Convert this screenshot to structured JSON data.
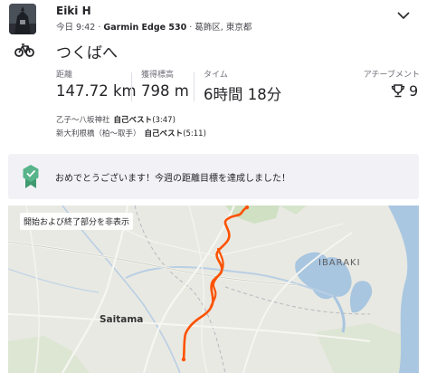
{
  "header": {
    "athlete_name": "Eiki H",
    "timestamp": "今日 9:42",
    "device": "Garmin Edge 530",
    "location": "葛飾区, 東京都",
    "separator": " · ",
    "avatar_icon": "profile-photo",
    "menu_icon": "chevron-down-icon"
  },
  "activity": {
    "sport_icon": "bicycle-icon",
    "title": "つくばへ"
  },
  "stats": {
    "distance_label": "距離",
    "distance_value": "147.72 km",
    "elevation_label": "獲得標高",
    "elevation_value": "798 m",
    "time_label": "タイム",
    "time_value": "6時間 18分",
    "achievements_label": "アチーブメント",
    "achievements_value": "9",
    "achievements_icon": "trophy-icon"
  },
  "segments": [
    {
      "name": "乙子～八坂神社",
      "badge": "自己ベスト",
      "time": "(3:47)"
    },
    {
      "name": "新大利根橋（柏～取手）",
      "badge": "自己ベスト",
      "time": "(5:11)"
    }
  ],
  "goal": {
    "text": "おめでとうございます！今週の距離目標を達成しました！",
    "icon": "goal-badge-icon",
    "color": "#58b48a"
  },
  "map": {
    "toggle_label": "開始および終了部分を非表示",
    "labels": {
      "ibaraki": "IBARAKI",
      "saitama": "Saitama"
    },
    "route_color": "#fc5200"
  }
}
